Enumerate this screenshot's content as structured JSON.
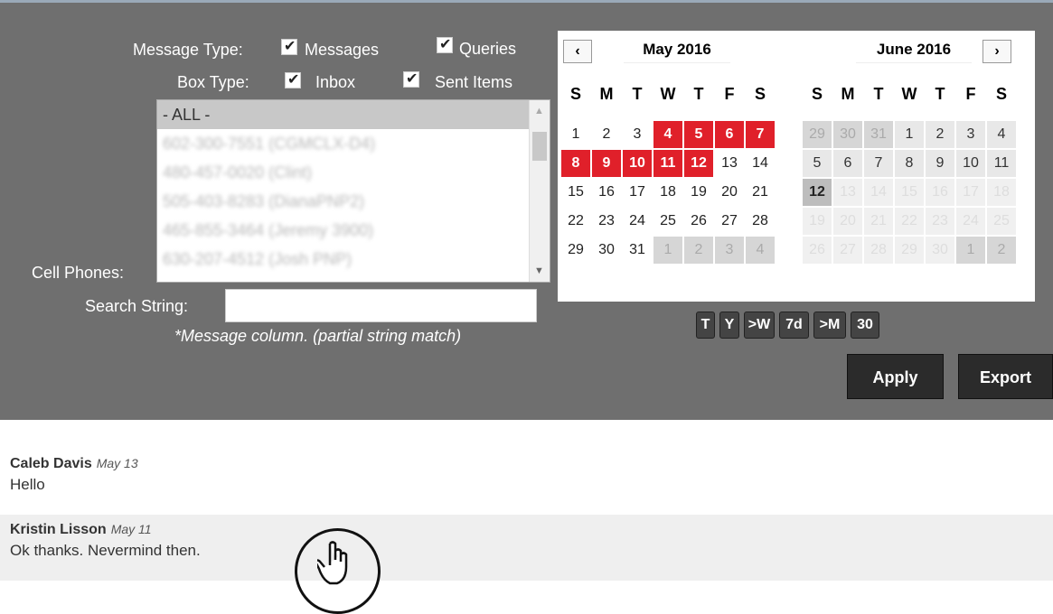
{
  "filters": {
    "message_type_label": "Message Type:",
    "messages_label": "Messages",
    "queries_label": "Queries",
    "box_type_label": "Box Type:",
    "inbox_label": "Inbox",
    "sent_items_label": "Sent Items",
    "cell_phones_label": "Cell Phones:",
    "phones": [
      "- ALL -",
      "602-300-7551 (CGMCLX-D4)",
      "480-457-0020 (Clint)",
      "505-403-8283 (DianaPNP2)",
      "465-855-3464 (Jeremy 3900)",
      "630-207-4512 (Josh PNP)"
    ],
    "search_label": "Search String:",
    "search_value": "",
    "note": "*Message column. (partial string match)"
  },
  "calendar": {
    "month1_title": "May 2016",
    "month2_title": "June 2016",
    "prev_icon": "chevron-left",
    "next_icon": "chevron-right",
    "dow": [
      "S",
      "M",
      "T",
      "W",
      "T",
      "F",
      "S"
    ],
    "month1_days": [
      {
        "d": "1",
        "s": ""
      },
      {
        "d": "2",
        "s": ""
      },
      {
        "d": "3",
        "s": ""
      },
      {
        "d": "4",
        "s": "sel"
      },
      {
        "d": "5",
        "s": "sel"
      },
      {
        "d": "6",
        "s": "sel"
      },
      {
        "d": "7",
        "s": "sel"
      },
      {
        "d": "8",
        "s": "sel"
      },
      {
        "d": "9",
        "s": "sel"
      },
      {
        "d": "10",
        "s": "sel"
      },
      {
        "d": "11",
        "s": "sel"
      },
      {
        "d": "12",
        "s": "sel"
      },
      {
        "d": "13",
        "s": ""
      },
      {
        "d": "14",
        "s": ""
      },
      {
        "d": "15",
        "s": ""
      },
      {
        "d": "16",
        "s": ""
      },
      {
        "d": "17",
        "s": ""
      },
      {
        "d": "18",
        "s": ""
      },
      {
        "d": "19",
        "s": ""
      },
      {
        "d": "20",
        "s": ""
      },
      {
        "d": "21",
        "s": ""
      },
      {
        "d": "22",
        "s": ""
      },
      {
        "d": "23",
        "s": ""
      },
      {
        "d": "24",
        "s": ""
      },
      {
        "d": "25",
        "s": ""
      },
      {
        "d": "26",
        "s": ""
      },
      {
        "d": "27",
        "s": ""
      },
      {
        "d": "28",
        "s": ""
      },
      {
        "d": "29",
        "s": ""
      },
      {
        "d": "30",
        "s": ""
      },
      {
        "d": "31",
        "s": ""
      },
      {
        "d": "1",
        "s": "other"
      },
      {
        "d": "2",
        "s": "other"
      },
      {
        "d": "3",
        "s": "other"
      },
      {
        "d": "4",
        "s": "other"
      }
    ],
    "month2_days": [
      {
        "d": "29",
        "s": "other"
      },
      {
        "d": "30",
        "s": "other"
      },
      {
        "d": "31",
        "s": "other"
      },
      {
        "d": "1",
        "s": "past"
      },
      {
        "d": "2",
        "s": "past"
      },
      {
        "d": "3",
        "s": "past"
      },
      {
        "d": "4",
        "s": "past"
      },
      {
        "d": "5",
        "s": "past"
      },
      {
        "d": "6",
        "s": "past"
      },
      {
        "d": "7",
        "s": "past"
      },
      {
        "d": "8",
        "s": "past"
      },
      {
        "d": "9",
        "s": "past"
      },
      {
        "d": "10",
        "s": "past"
      },
      {
        "d": "11",
        "s": "past"
      },
      {
        "d": "12",
        "s": "today"
      },
      {
        "d": "13",
        "s": "dis"
      },
      {
        "d": "14",
        "s": "dis"
      },
      {
        "d": "15",
        "s": "dis"
      },
      {
        "d": "16",
        "s": "dis"
      },
      {
        "d": "17",
        "s": "dis"
      },
      {
        "d": "18",
        "s": "dis"
      },
      {
        "d": "19",
        "s": "dis"
      },
      {
        "d": "20",
        "s": "dis"
      },
      {
        "d": "21",
        "s": "dis"
      },
      {
        "d": "22",
        "s": "dis"
      },
      {
        "d": "23",
        "s": "dis"
      },
      {
        "d": "24",
        "s": "dis"
      },
      {
        "d": "25",
        "s": "dis"
      },
      {
        "d": "26",
        "s": "dis"
      },
      {
        "d": "27",
        "s": "dis"
      },
      {
        "d": "28",
        "s": "dis"
      },
      {
        "d": "29",
        "s": "dis"
      },
      {
        "d": "30",
        "s": "dis"
      },
      {
        "d": "1",
        "s": "other"
      },
      {
        "d": "2",
        "s": "other"
      }
    ],
    "quick_ranges": [
      "T",
      "Y",
      ">W",
      "7d",
      ">M",
      "30"
    ]
  },
  "actions": {
    "apply_label": "Apply",
    "export_label": "Export"
  },
  "messages": [
    {
      "name": "Caleb Davis",
      "date": "May 13",
      "text": "Hello"
    },
    {
      "name": "Kristin Lisson",
      "date": "May 11",
      "text": "Ok thanks. Nevermind then."
    }
  ],
  "colors": {
    "panel_bg": "#6f6f6f",
    "selected_day": "#e0202a",
    "button_bg": "#2b2b2b"
  },
  "cursor_icon": "hand-pointer-icon"
}
